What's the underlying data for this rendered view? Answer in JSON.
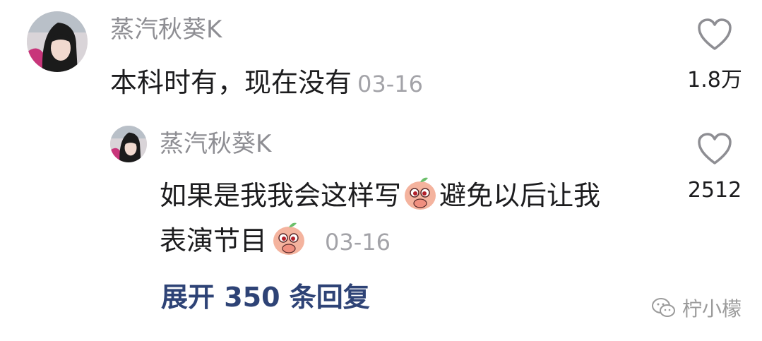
{
  "comment": {
    "username": "蒸汽秋葵K",
    "text": "本科时有，现在没有",
    "date": "03-16",
    "likes": "1.8万"
  },
  "reply": {
    "username": "蒸汽秋葵K",
    "text_part1": "如果是我我会这样写",
    "text_part2": "避免以后让我",
    "text_part3": "表演节目",
    "date": "03-16",
    "likes": "2512",
    "emoji_icon": "covering-mouth-peach-emoji"
  },
  "expand_replies": "展开 350 条回复",
  "watermark": "柠小檬",
  "colors": {
    "username": "#8e8e93",
    "text": "#1c1c1e",
    "date": "#a3a3a8",
    "link": "#2e4376"
  }
}
